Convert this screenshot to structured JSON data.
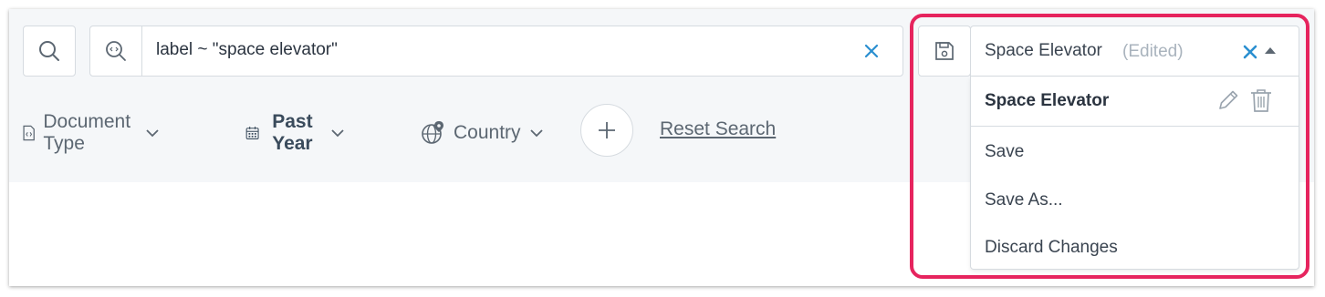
{
  "search": {
    "query_value": "label ~ \"space elevator\"",
    "search_icon": "search-icon",
    "query_icon": "code-search-icon",
    "clear_icon": "clear-icon"
  },
  "filters": {
    "document_type": {
      "label": "Document Type",
      "icon": "document-code-icon"
    },
    "date": {
      "label": "Past Year",
      "icon": "calendar-icon"
    },
    "country": {
      "label": "Country",
      "icon": "globe-pin-icon"
    },
    "add_icon": "plus-icon",
    "reset_label": "Reset Search"
  },
  "saved_search": {
    "selected_name": "Space Elevator",
    "edited_label": "(Edited)",
    "save_icon": "floppy-disk-icon",
    "dropdown": {
      "header_name": "Space Elevator",
      "items": [
        "Save",
        "Save As...",
        "Discard Changes"
      ]
    }
  },
  "colors": {
    "accent_blue": "#2a8fd0",
    "highlight_pink": "#e6245e",
    "text_dark": "#2b3440",
    "text_muted": "#5c6772",
    "band_bg": "#f5f7f9"
  }
}
